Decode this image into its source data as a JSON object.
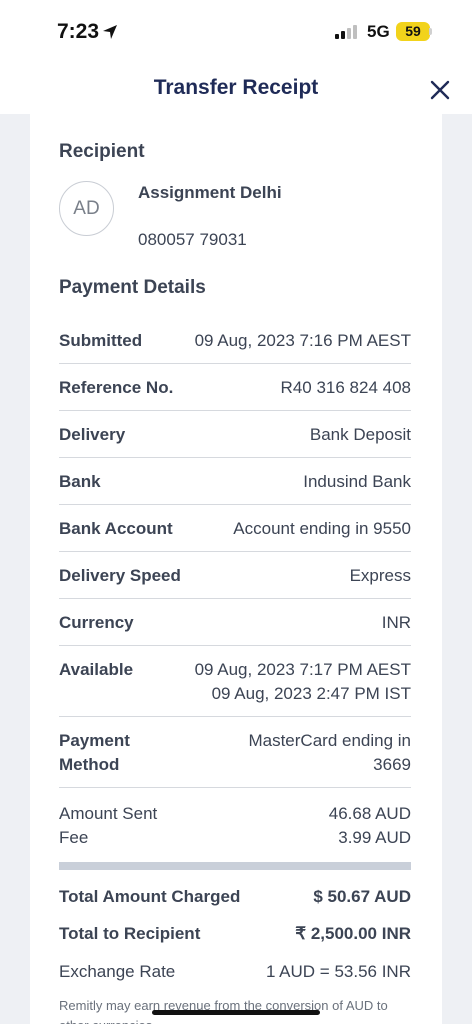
{
  "status_bar": {
    "time": "7:23",
    "network": "5G",
    "battery": "59"
  },
  "nav": {
    "title": "Transfer Receipt"
  },
  "recipient": {
    "section_title": "Recipient",
    "initials": "AD",
    "name": "Assignment Delhi",
    "account": "080057 79031"
  },
  "payment_details": {
    "section_title": "Payment Details",
    "rows": [
      {
        "label": "Submitted",
        "value": "09 Aug, 2023 7:16 PM AEST"
      },
      {
        "label": "Reference No.",
        "value": "R40 316 824 408"
      },
      {
        "label": "Delivery",
        "value": "Bank Deposit"
      },
      {
        "label": "Bank",
        "value": "Indusind Bank"
      },
      {
        "label": "Bank Account",
        "value": "Account ending in 9550"
      },
      {
        "label": "Delivery Speed",
        "value": "Express"
      },
      {
        "label": "Currency",
        "value": "INR"
      }
    ],
    "available": {
      "label": "Available",
      "value_line1": "09 Aug, 2023 7:17 PM AEST",
      "value_line2": "09 Aug, 2023 2:47 PM IST"
    },
    "payment_method": {
      "label_line1": "Payment",
      "label_line2": "Method",
      "value_line1": "MasterCard ending in",
      "value_line2": "3669"
    }
  },
  "amounts": {
    "amount_sent": {
      "label": "Amount Sent",
      "value": "46.68 AUD"
    },
    "fee": {
      "label": "Fee",
      "value": "3.99 AUD"
    },
    "total_charged": {
      "label": "Total Amount Charged",
      "value": "$ 50.67 AUD"
    },
    "total_recipient": {
      "label": "Total to Recipient",
      "value": "₹ 2,500.00 INR"
    },
    "exchange_rate": {
      "label": "Exchange Rate",
      "value": "1 AUD = 53.56 INR"
    }
  },
  "footnote": "Remitly may earn revenue from the conversion of AUD to other currencies."
}
